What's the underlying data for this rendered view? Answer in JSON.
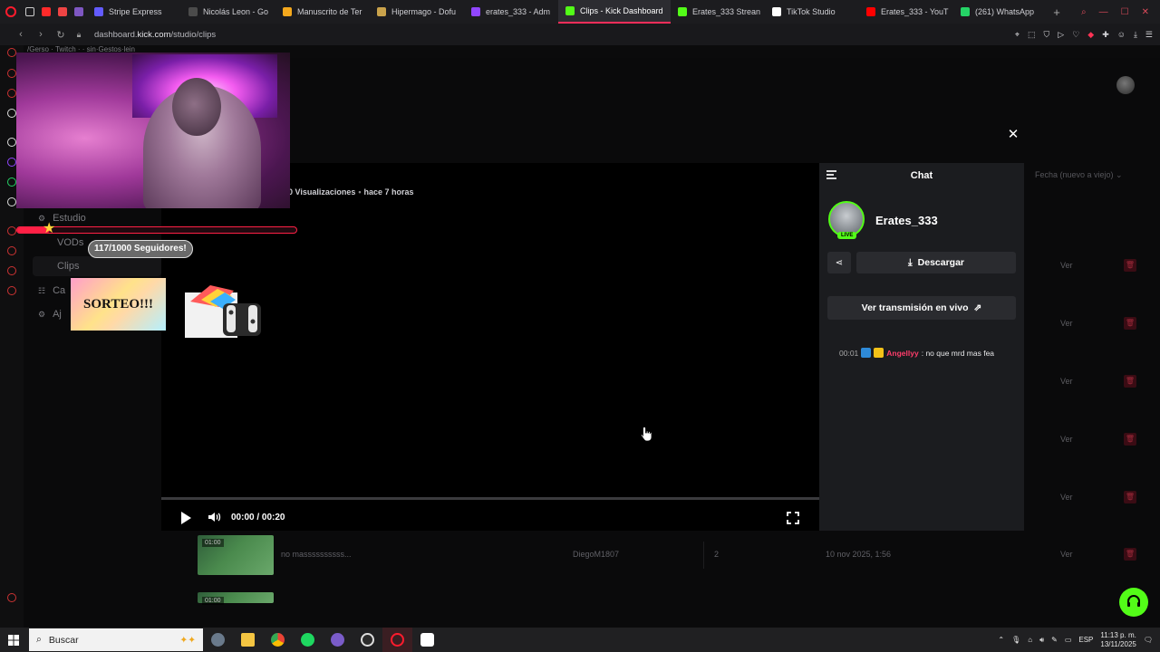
{
  "browser": {
    "tabs": [
      {
        "label": "Stripe Express",
        "color": "#635bff"
      },
      {
        "label": "Nicolás Leon - Go",
        "color": "#4b4b4b"
      },
      {
        "label": "Manuscrito de Ter",
        "color": "#f4a81d"
      },
      {
        "label": "Hipermago - Dofu",
        "color": "#c9a24b"
      },
      {
        "label": "erates_333 - Adm",
        "color": "#9146ff"
      },
      {
        "label": "Clips - Kick Dashboard",
        "color": "#53fc18",
        "active": true
      },
      {
        "label": "Erates_333 Strean",
        "color": "#53fc18"
      },
      {
        "label": "TikTok Studio",
        "color": "#ffffff"
      },
      {
        "label": "Erates_333 - YouT",
        "color": "#ff0000"
      },
      {
        "label": "(261) WhatsApp",
        "color": "#25d366"
      }
    ],
    "url_prefix": "dashboard.",
    "url_domain": "kick.com",
    "url_path": "/studio/clips",
    "bookmarks_text": "/Gerso · Twitch ·  ·  sin·Gestos·lein"
  },
  "sidenav": {
    "items": [
      {
        "label": "Estudio"
      },
      {
        "label": "VODs"
      },
      {
        "label": "Clips"
      },
      {
        "label": "Ca"
      },
      {
        "label": "Aj"
      }
    ]
  },
  "video": {
    "views": "0 Visualizaciones",
    "separator": "•",
    "ago": "hace 7 horas",
    "time": "00:00 / 00:20",
    "progress": 0
  },
  "overlay": {
    "followers_label": "117/1000 Seguidores!",
    "followers_current": 117,
    "followers_goal": 1000,
    "sorteo_label": "SORTEO!!!"
  },
  "chat": {
    "title": "Chat",
    "channel": "Erates_333",
    "live_badge": "LIVE",
    "download_label": "Descargar",
    "watch_live_label": "Ver transmisión en vivo",
    "message": {
      "time": "00:01",
      "user": "Angellyy",
      "text": ": no que mrd mas fea"
    }
  },
  "table": {
    "sort_label": "Fecha (nuevo a viejo)",
    "view_label": "Ver",
    "row": {
      "duration": "01:00",
      "title": "no massssssssss...",
      "author": "DiegoM1807",
      "count": "2",
      "date": "10 nov 2025, 1:56"
    },
    "next_duration": "01:00"
  },
  "taskbar": {
    "search_placeholder": "Buscar",
    "lang": "ESP",
    "time": "11:13 p. m.",
    "date": "13/11/2025"
  },
  "colors": {
    "kick_green": "#53fc18",
    "accent_red": "#ff2045"
  }
}
